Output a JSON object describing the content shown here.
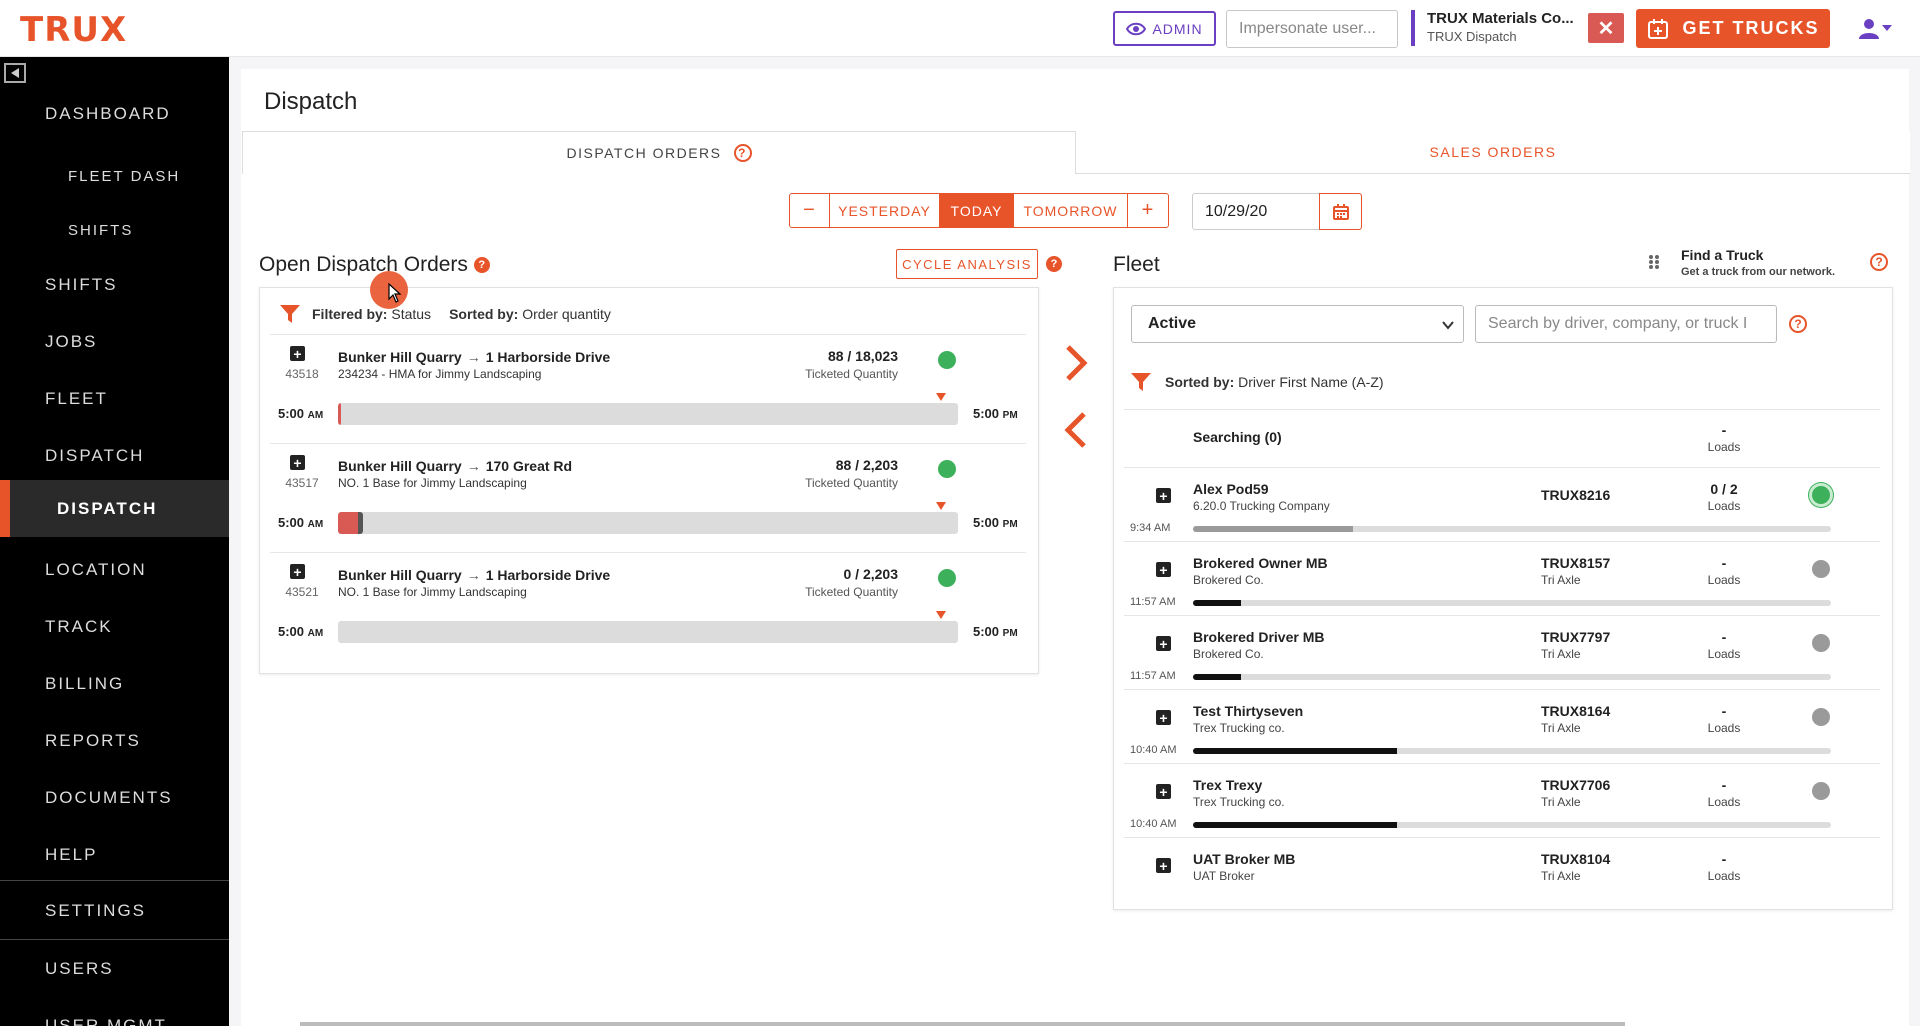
{
  "header": {
    "logo": "TRUX",
    "admin_label": "ADMIN",
    "impersonate_placeholder": "Impersonate user...",
    "company_name": "TRUX Materials Co...",
    "company_sub": "TRUX Dispatch",
    "close_label": "✕",
    "get_trucks_label": "GET TRUCKS"
  },
  "sidebar": {
    "items": [
      {
        "label": "DASHBOARD"
      },
      {
        "label": "FLEET DASH"
      },
      {
        "label": "SHIFTS"
      },
      {
        "label": "SHIFTS"
      },
      {
        "label": "JOBS"
      },
      {
        "label": "FLEET"
      },
      {
        "label": "DISPATCH"
      },
      {
        "label": "DISPATCH"
      },
      {
        "label": "LOCATION"
      },
      {
        "label": "TRACK"
      },
      {
        "label": "BILLING"
      },
      {
        "label": "REPORTS"
      },
      {
        "label": "DOCUMENTS"
      },
      {
        "label": "HELP"
      },
      {
        "label": "SETTINGS"
      },
      {
        "label": "USERS"
      },
      {
        "label": "USER MGMT"
      }
    ]
  },
  "page": {
    "title": "Dispatch",
    "tabs": [
      {
        "label": "DISPATCH ORDERS",
        "help": "?"
      },
      {
        "label": "SALES ORDERS"
      }
    ]
  },
  "date_controls": {
    "minus": "−",
    "yesterday": "YESTERDAY",
    "today": "TODAY",
    "tomorrow": "TOMORROW",
    "plus": "+",
    "date_value": "10/29/20"
  },
  "orders": {
    "title": "Open Dispatch Orders",
    "help": "?",
    "cycle_label": "CYCLE ANALYSIS",
    "filtered_label": "Filtered by:",
    "filtered_value": "Status",
    "sorted_label": "Sorted by:",
    "sorted_value": "Order quantity",
    "items": [
      {
        "id": "43518",
        "from": "Bunker Hill Quarry",
        "to": "1 Harborside Drive",
        "desc": "234234 - HMA for Jimmy Landscaping",
        "qty": "88 / 18,023",
        "qty_label": "Ticketed Quantity",
        "start": "5:00",
        "start_ampm": "AM",
        "end": "5:00",
        "end_ampm": "PM",
        "progress": 0.005
      },
      {
        "id": "43517",
        "from": "Bunker Hill Quarry",
        "to": "170 Great Rd",
        "desc": "NO. 1 Base for Jimmy Landscaping",
        "qty": "88 / 2,203",
        "qty_label": "Ticketed Quantity",
        "start": "5:00",
        "start_ampm": "AM",
        "end": "5:00",
        "end_ampm": "PM",
        "progress": 0.04
      },
      {
        "id": "43521",
        "from": "Bunker Hill Quarry",
        "to": "1 Harborside Drive",
        "desc": "NO. 1 Base for Jimmy Landscaping",
        "qty": "0 / 2,203",
        "qty_label": "Ticketed Quantity",
        "start": "5:00",
        "start_ampm": "AM",
        "end": "5:00",
        "end_ampm": "PM",
        "progress": 0
      }
    ]
  },
  "fleet": {
    "title": "Fleet",
    "find_title": "Find a Truck",
    "find_sub": "Get a truck from our network.",
    "help": "?",
    "status_value": "Active",
    "search_placeholder": "Search by driver, company, or truck I",
    "sorted_label": "Sorted by:",
    "sorted_value": "Driver First Name (A-Z)",
    "searching_label": "Searching (0)",
    "searching_loads": "-",
    "searching_loads_label": "Loads",
    "trucks": [
      {
        "driver": "Alex Pod59",
        "company": "6.20.0 Trucking Company",
        "truck": "TRUX8216",
        "axle": "",
        "loads": "0 / 2",
        "loads_label": "Loads",
        "time": "9:34 AM",
        "status": "green",
        "progress": 0.25
      },
      {
        "driver": "Brokered Owner MB",
        "company": "Brokered Co.",
        "truck": "TRUX8157",
        "axle": "Tri Axle",
        "loads": "-",
        "loads_label": "Loads",
        "time": "11:57 AM",
        "status": "grey",
        "progress": 0.075
      },
      {
        "driver": "Brokered Driver MB",
        "company": "Brokered Co.",
        "truck": "TRUX7797",
        "axle": "Tri Axle",
        "loads": "-",
        "loads_label": "Loads",
        "time": "11:57 AM",
        "status": "grey",
        "progress": 0.075
      },
      {
        "driver": "Test Thirtyseven",
        "company": "Trex Trucking co.",
        "truck": "TRUX8164",
        "axle": "Tri Axle",
        "loads": "-",
        "loads_label": "Loads",
        "time": "10:40 AM",
        "status": "grey",
        "progress": 0.32
      },
      {
        "driver": "Trex Trexy",
        "company": "Trex Trucking co.",
        "truck": "TRUX7706",
        "axle": "Tri Axle",
        "loads": "-",
        "loads_label": "Loads",
        "time": "10:40 AM",
        "status": "grey",
        "progress": 0.32
      },
      {
        "driver": "UAT Broker MB",
        "company": "UAT Broker",
        "truck": "TRUX8104",
        "axle": "Tri Axle",
        "loads": "-",
        "loads_label": "Loads",
        "time": "",
        "status": "none",
        "progress": null
      }
    ]
  },
  "colors": {
    "accent": "#e8542a",
    "admin": "#6a3fc2",
    "status_green": "#3cb05a",
    "status_grey": "#9a9a9a",
    "progress_red": "#d95a54"
  }
}
